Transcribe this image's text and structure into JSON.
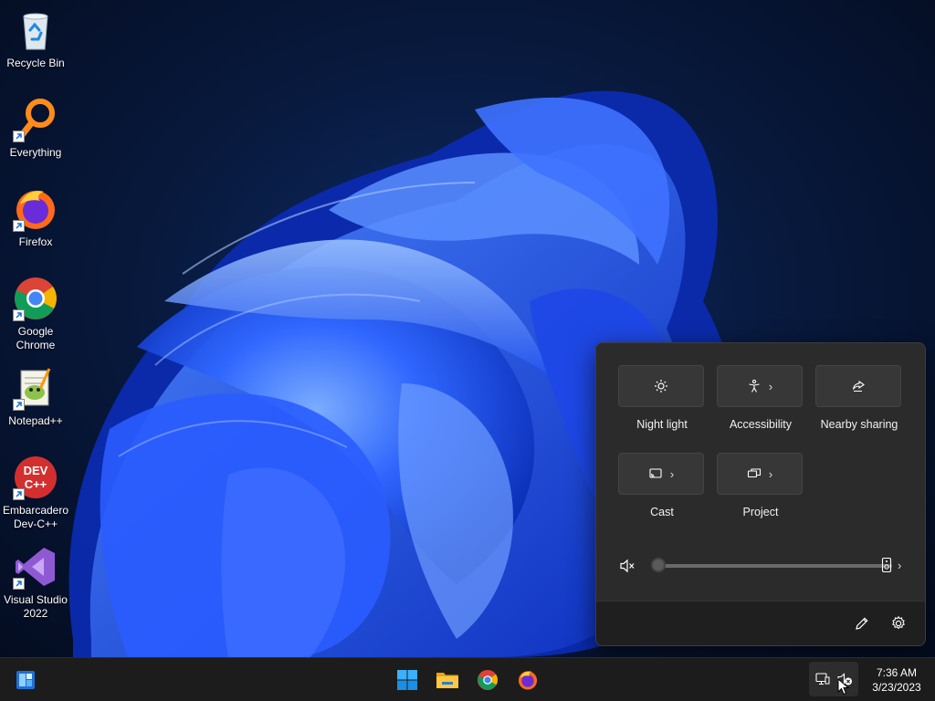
{
  "desktop": {
    "icons": [
      {
        "label": "Recycle Bin",
        "icon": "recycle-bin-icon",
        "shortcut": false
      },
      {
        "label": "Everything",
        "icon": "everything-search-icon",
        "shortcut": true
      },
      {
        "label": "Firefox",
        "icon": "firefox-icon",
        "shortcut": true
      },
      {
        "label": "Google Chrome",
        "icon": "chrome-icon",
        "shortcut": true
      },
      {
        "label": "Notepad++",
        "icon": "notepad-plus-plus-icon",
        "shortcut": true
      },
      {
        "label": "Embarcadero Dev-C++",
        "icon": "dev-cpp-icon",
        "shortcut": true
      },
      {
        "label": "Visual Studio 2022",
        "icon": "visual-studio-icon",
        "shortcut": true
      }
    ],
    "devcpp_badge": {
      "line1": "DEV",
      "line2": "C++"
    }
  },
  "quick_settings": {
    "tiles": [
      {
        "label": "Night light",
        "icon": "night-light-icon",
        "expand": false
      },
      {
        "label": "Accessibility",
        "icon": "accessibility-icon",
        "expand": true
      },
      {
        "label": "Nearby sharing",
        "icon": "nearby-sharing-icon",
        "expand": false
      },
      {
        "label": "Cast",
        "icon": "cast-icon",
        "expand": true
      },
      {
        "label": "Project",
        "icon": "project-icon",
        "expand": true
      }
    ],
    "volume": {
      "level": 0,
      "muted": true,
      "output_icon": "speaker-device-icon"
    },
    "footer": {
      "edit_icon": "pencil-icon",
      "settings_icon": "gear-icon"
    },
    "chevron": "›"
  },
  "taskbar": {
    "pinned": [
      "start-icon",
      "windows-icon",
      "file-explorer-icon",
      "chrome-icon",
      "firefox-icon"
    ],
    "tray": {
      "network_icon": "network-icon",
      "volume_icon": "volume-muted-icon"
    },
    "clock": {
      "time": "7:36 AM",
      "date": "3/23/2023"
    }
  },
  "colors": {
    "accent": "#1a8fe3",
    "wallpaper_bloom": "#2a5cff",
    "flyout_bg": "#2b2b2b",
    "taskbar_bg": "#1c1c1c"
  }
}
